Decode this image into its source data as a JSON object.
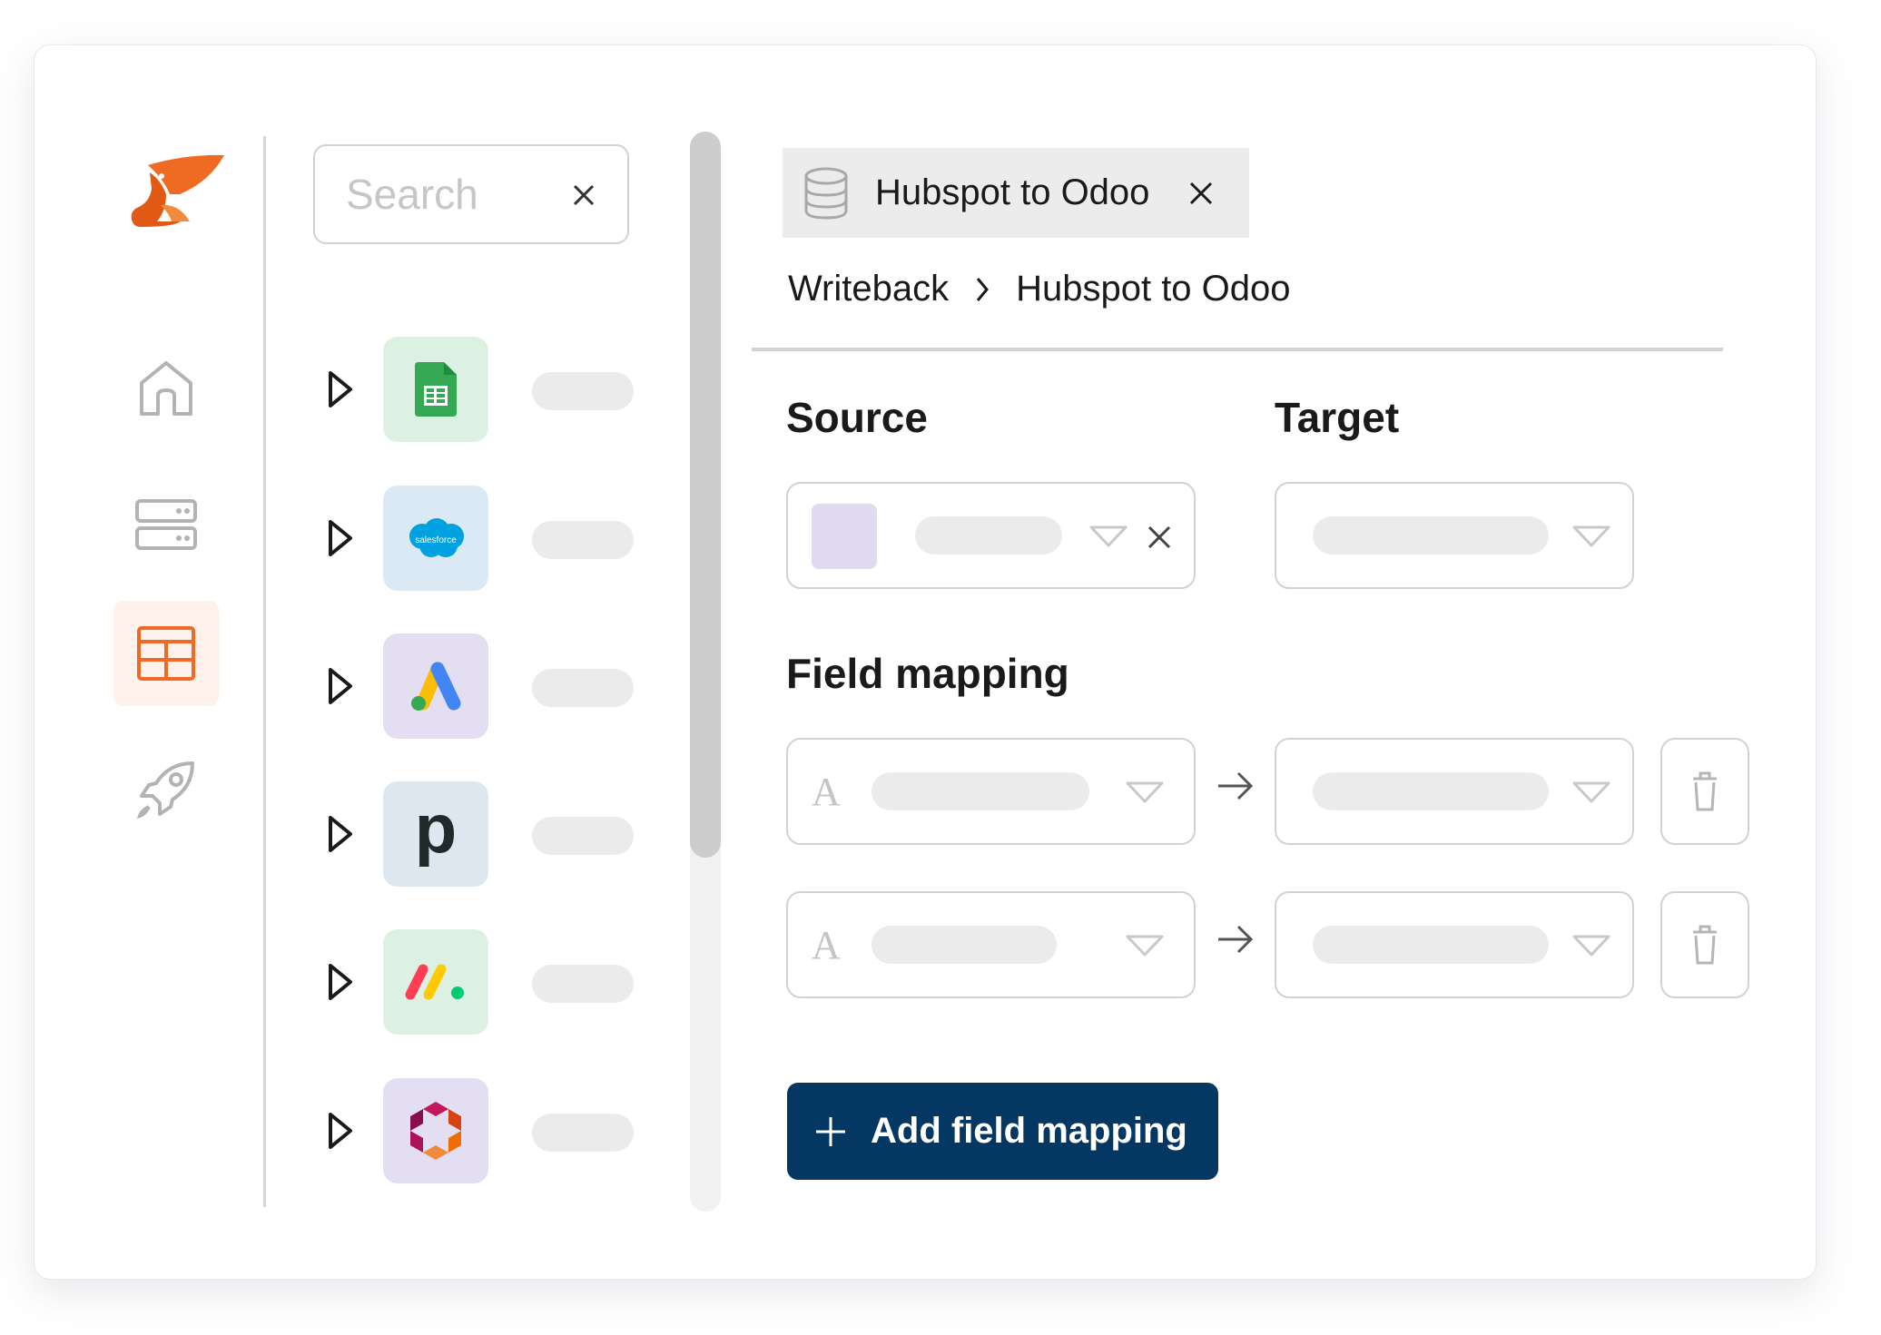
{
  "search": {
    "placeholder": "Search"
  },
  "sidebar": {
    "nav": [
      {
        "name": "home-icon"
      },
      {
        "name": "server-icon"
      },
      {
        "name": "table-icon",
        "active": true
      },
      {
        "name": "rocket-icon"
      }
    ],
    "connectors": [
      {
        "icon": "google-sheets-icon",
        "tile_color": "#dcf1e2"
      },
      {
        "icon": "salesforce-icon",
        "tile_color": "#dbe9f4",
        "logo_text": "salesforce"
      },
      {
        "icon": "google-ads-icon",
        "tile_color": "#e4def2"
      },
      {
        "icon": "pipedrive-icon",
        "tile_color": "#dce7f0",
        "logo_text": "p"
      },
      {
        "icon": "monday-icon",
        "tile_color": "#dcf1e2"
      },
      {
        "icon": "hexagon-logo-icon",
        "tile_color": "#e4def2"
      }
    ]
  },
  "tab": {
    "label": "Hubspot to Odoo",
    "icon": "database-icon"
  },
  "breadcrumb": {
    "parent": "Writeback",
    "current": "Hubspot to Odoo"
  },
  "sections": {
    "source": "Source",
    "target": "Target",
    "field_mapping": "Field mapping"
  },
  "mapping_rows": [
    {
      "type_glyph": "A"
    },
    {
      "type_glyph": "A"
    }
  ],
  "actions": {
    "add_field_mapping": "Add field mapping"
  },
  "colors": {
    "brand_orange": "#ef6a22",
    "primary_navy": "#053763",
    "active_nav_bg": "#fff2ec",
    "source_swatch": "#e0dbf1"
  }
}
